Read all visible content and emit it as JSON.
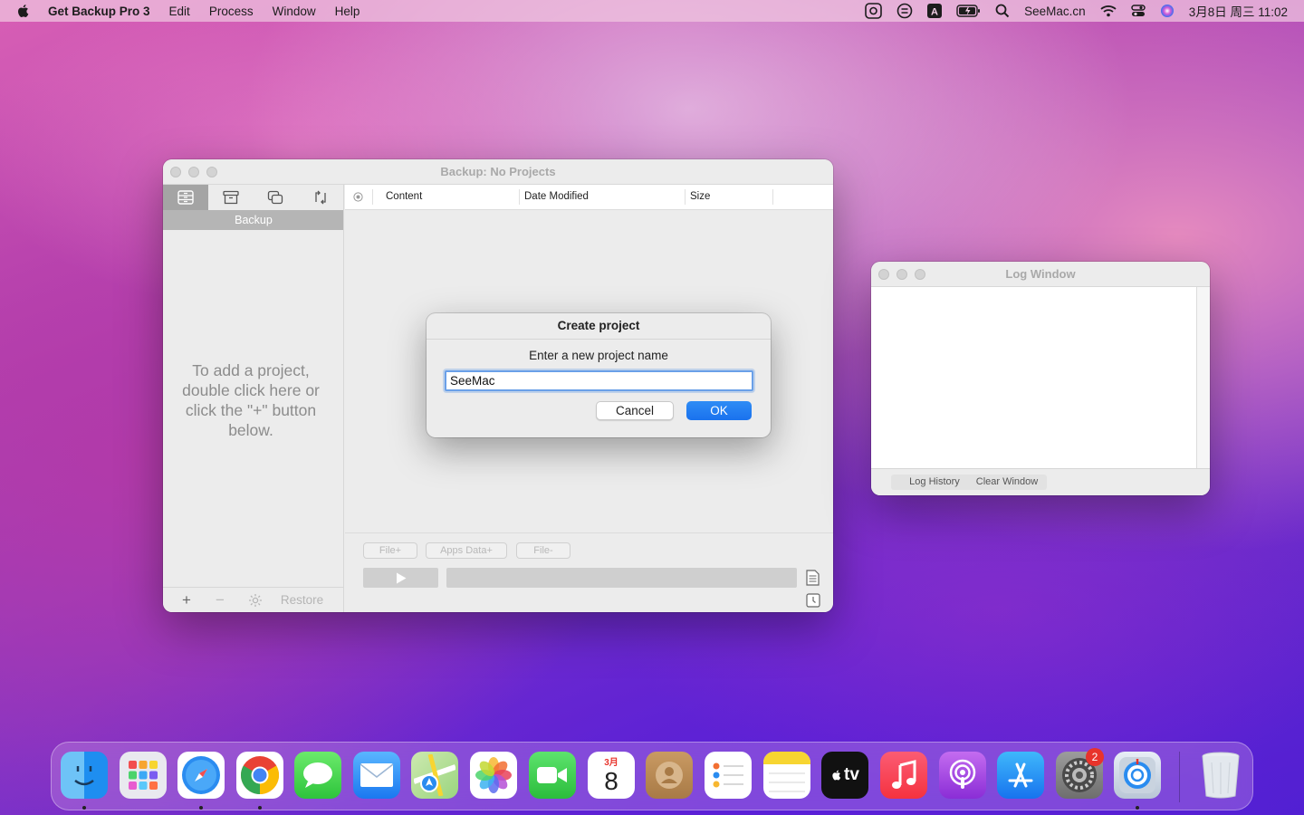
{
  "menubar": {
    "app_name": "Get Backup Pro 3",
    "menus": [
      "Edit",
      "Process",
      "Window",
      "Help"
    ],
    "brand": "SeeMac.cn",
    "datetime": "3月8日 周三  11:02",
    "tray_icons": [
      "screenshot-icon",
      "script-icon",
      "input-method-icon",
      "battery-icon",
      "search-icon",
      "wifi-icon",
      "control-center-icon",
      "siri-icon"
    ]
  },
  "main_window": {
    "title": "Backup: No Projects",
    "sidebar": {
      "tabs": [
        "backup-tab-icon",
        "archive-tab-icon",
        "clone-tab-icon",
        "sync-tab-icon"
      ],
      "active_tab_label": "Backup",
      "hint": "To add a project, double click here or click the \"+\" button below.",
      "add_label": "+",
      "remove_label": "−",
      "restore_label": "Restore"
    },
    "table": {
      "columns": [
        "Content",
        "Date Modified",
        "Size"
      ]
    },
    "buttons": {
      "file_plus": "File+",
      "apps_data_plus": "Apps Data+",
      "file_minus": "File-"
    }
  },
  "dialog": {
    "title": "Create project",
    "message": "Enter a new project name",
    "input_value": "SeeMac",
    "cancel_label": "Cancel",
    "ok_label": "OK"
  },
  "log_window": {
    "title": "Log Window",
    "log_history_label": "Log History",
    "clear_window_label": "Clear Window"
  },
  "dock": {
    "calendar_month": "3月",
    "calendar_day": "8",
    "tv_label": "tv",
    "settings_badge": "2",
    "apps": [
      "finder-icon",
      "launchpad-icon",
      "safari-icon",
      "chrome-icon",
      "messages-icon",
      "mail-icon",
      "maps-icon",
      "photos-icon",
      "facetime-icon",
      "calendar-icon",
      "contacts-icon",
      "reminders-icon",
      "notes-icon",
      "apple-tv-icon",
      "music-icon",
      "podcasts-icon",
      "app-store-icon",
      "system-preferences-icon",
      "get-backup-pro-icon",
      "trash-icon"
    ]
  }
}
